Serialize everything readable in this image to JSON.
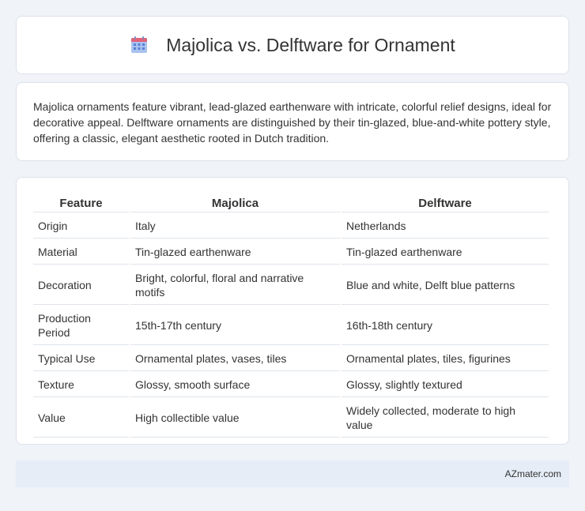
{
  "header": {
    "title": "Majolica vs. Delftware for Ornament",
    "icon": "calendar-icon",
    "icon_colors": {
      "top": "#e0637a",
      "body": "#9db8ea",
      "dots": "#5b7fd6"
    }
  },
  "summary": {
    "text": "Majolica ornaments feature vibrant, lead-glazed earthenware with intricate, colorful relief designs, ideal for decorative appeal. Delftware ornaments are distinguished by their tin-glazed, blue-and-white pottery style, offering a classic, elegant aesthetic rooted in Dutch tradition."
  },
  "table": {
    "headers": [
      "Feature",
      "Majolica",
      "Delftware"
    ],
    "rows": [
      [
        "Origin",
        "Italy",
        "Netherlands"
      ],
      [
        "Material",
        "Tin-glazed earthenware",
        "Tin-glazed earthenware"
      ],
      [
        "Decoration",
        "Bright, colorful, floral and narrative motifs",
        "Blue and white, Delft blue patterns"
      ],
      [
        "Production Period",
        "15th-17th century",
        "16th-18th century"
      ],
      [
        "Typical Use",
        "Ornamental plates, vases, tiles",
        "Ornamental plates, tiles, figurines"
      ],
      [
        "Texture",
        "Glossy, smooth surface",
        "Glossy, slightly textured"
      ],
      [
        "Value",
        "High collectible value",
        "Widely collected, moderate to high value"
      ]
    ]
  },
  "footer": {
    "text": "AZmater.com"
  }
}
